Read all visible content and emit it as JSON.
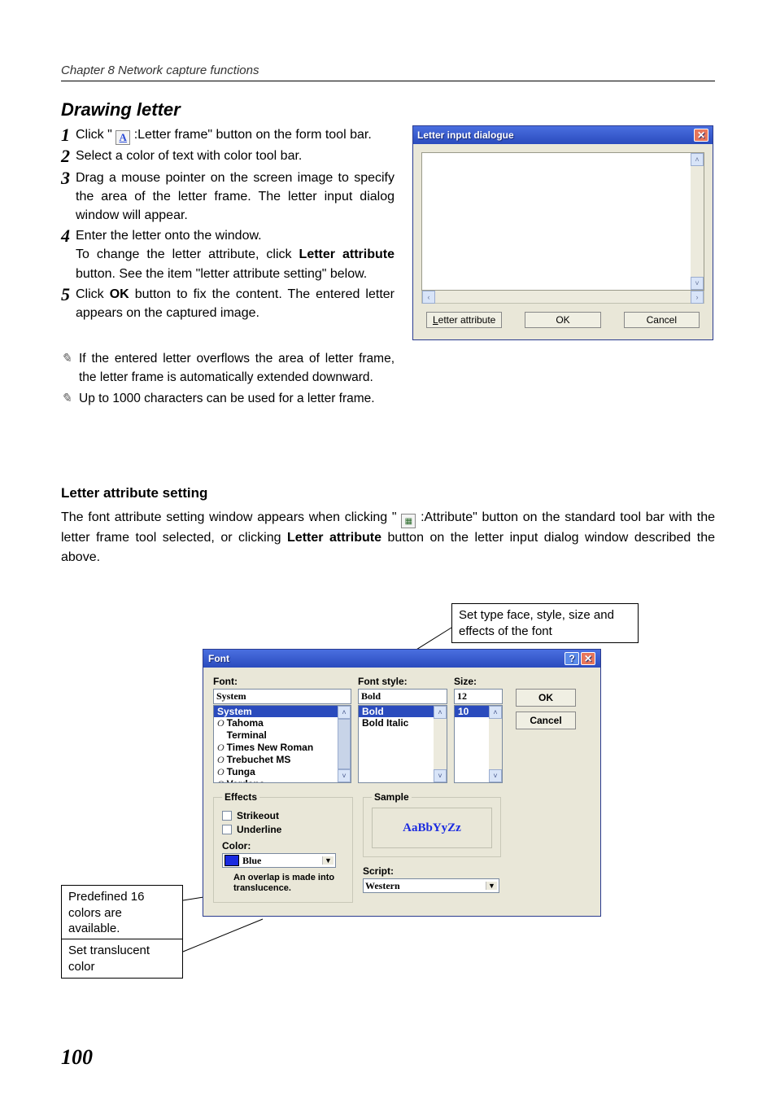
{
  "chapter_header": "Chapter 8 Network capture functions",
  "section_title": "Drawing letter",
  "steps": {
    "s1a": "Click \"",
    "s1b": ":Letter frame\" button on the form tool bar.",
    "s2": "Select a color of text with color tool bar.",
    "s3": "Drag a mouse pointer on the screen image to specify the area of the letter frame. The letter input dialog window will appear.",
    "s4a": "Enter the letter onto the window.",
    "s4b_pre": "To change the letter attribute, click ",
    "s4b_bold": "Letter attribute",
    "s4b_post": " button. See the item \"letter attribute setting\" below.",
    "s5_pre": "Click ",
    "s5_bold": "OK",
    "s5_post": " button to fix the content. The entered letter appears on the captured image."
  },
  "notes": {
    "n1": "If the entered letter overflows the area of letter frame, the letter frame is automatically extended downward.",
    "n2": "Up to 1000 characters can be used for a letter frame."
  },
  "subhead": "Letter attribute setting",
  "attr_para": {
    "p1": "The font attribute setting window appears when clicking \"",
    "p2": ":Attribute\" button on the standard tool bar with the letter frame tool selected, or clicking ",
    "p2_bold": "Letter attribute",
    "p3": " button on the letter input dialog window described the above."
  },
  "dlg1": {
    "title": "Letter input dialogue",
    "btn_attr": "Letter attribute",
    "btn_ok": "OK",
    "btn_cancel": "Cancel"
  },
  "callouts": {
    "top": "Set type face, style, size and effects of the font",
    "mid": "Predefined 16 colors are available.",
    "bot": "Set translucent color"
  },
  "dlg2": {
    "title": "Font",
    "font_label": "Font:",
    "font_value": "System",
    "font_options": [
      "System",
      "Tahoma",
      "Terminal",
      "Times New Roman",
      "Trebuchet MS",
      "Tunga",
      "Verdana"
    ],
    "style_label": "Font style:",
    "style_value": "Bold",
    "style_options": [
      "Bold",
      "Bold Italic"
    ],
    "size_label": "Size:",
    "size_value": "12",
    "size_options": [
      "10"
    ],
    "ok": "OK",
    "cancel": "Cancel",
    "effects_legend": "Effects",
    "strikeout": "Strikeout",
    "underline": "Underline",
    "color_label": "Color:",
    "color_value": "Blue",
    "overlap_note": "An overlap is made into translucence.",
    "sample_legend": "Sample",
    "sample_text": "AaBbYyZz",
    "script_label": "Script:",
    "script_value": "Western"
  },
  "page_number": "100",
  "icons": {
    "letter_a": "A",
    "attr": "▦"
  }
}
